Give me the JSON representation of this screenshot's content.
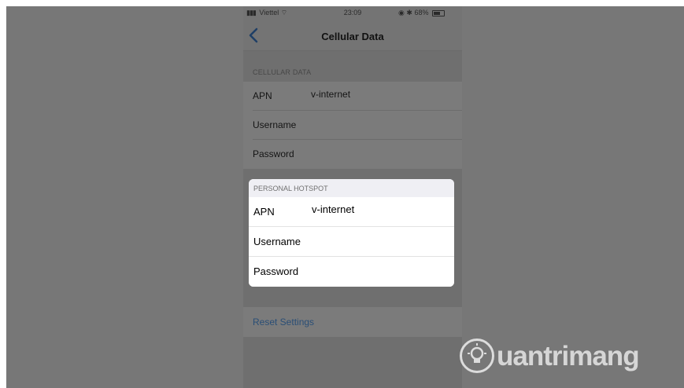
{
  "status_bar": {
    "carrier": "Viettel",
    "time": "23:09",
    "battery": "68%"
  },
  "nav": {
    "title": "Cellular Data"
  },
  "cellular": {
    "header": "CELLULAR DATA",
    "rows": [
      {
        "label": "APN",
        "value": "v-internet"
      },
      {
        "label": "Username",
        "value": ""
      },
      {
        "label": "Password",
        "value": ""
      }
    ]
  },
  "hotspot": {
    "header": "PERSONAL HOTSPOT",
    "rows": [
      {
        "label": "APN",
        "value": "v-internet"
      },
      {
        "label": "Username",
        "value": ""
      },
      {
        "label": "Password",
        "value": ""
      }
    ]
  },
  "reset": {
    "label": "Reset Settings"
  },
  "watermark": {
    "text": "uantrimang"
  },
  "colors": {
    "overlay": "#777777",
    "link": "#2a4e76",
    "popup_bg": "#ffffff",
    "popup_header": "#efeff4"
  }
}
